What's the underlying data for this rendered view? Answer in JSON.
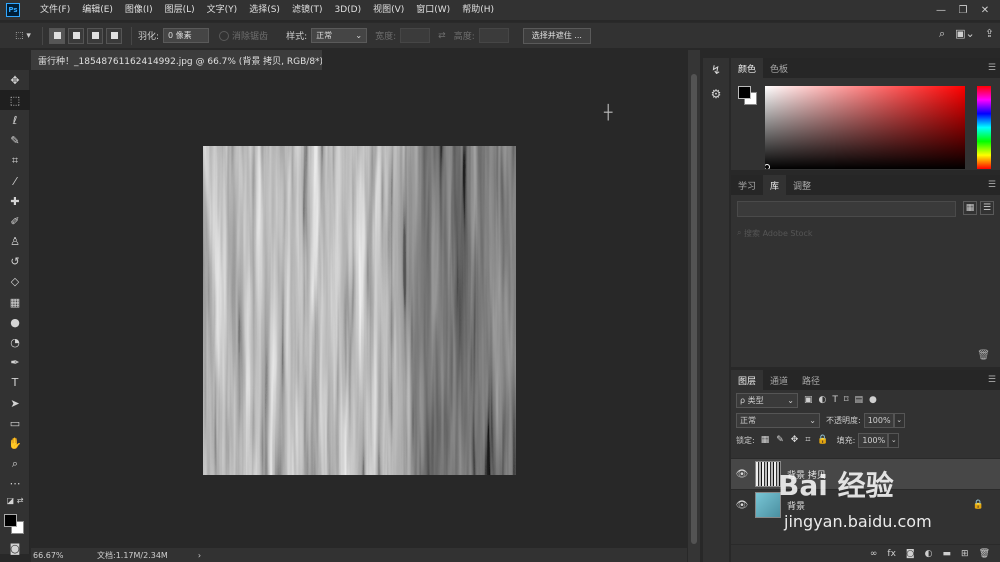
{
  "app": {
    "logo_text": "Ps"
  },
  "menu": [
    "文件(F)",
    "编辑(E)",
    "图像(I)",
    "图层(L)",
    "文字(Y)",
    "选择(S)",
    "滤镜(T)",
    "3D(D)",
    "视图(V)",
    "窗口(W)",
    "帮助(H)"
  ],
  "window_controls": {
    "minimize": "—",
    "restore": "❐",
    "close": "✕"
  },
  "options": {
    "feather_label": "羽化:",
    "feather_value": "0 像素",
    "antialias_label": "消除锯齿",
    "style_label": "样式:",
    "style_value": "正常",
    "width_label": "宽度:",
    "height_label": "高度:",
    "select_mask_button": "选择并遮住 ..."
  },
  "document": {
    "tab_title": "雷行种！_18548761162414992.jpg @ 66.7% (背景 拷贝, RGB/8*) *",
    "close": "×",
    "zoom": "66.67%",
    "doc_info": "文档:1.17M/2.34M"
  },
  "panels": {
    "color_tabs": [
      "颜色",
      "色板"
    ],
    "library_tabs": [
      "学习",
      "库",
      "调整"
    ],
    "library_search_placeholder": "搜索 Adobe Stock",
    "layers_tabs": [
      "图层",
      "通道",
      "路径"
    ]
  },
  "layers": {
    "filter_label": "ρ 类型",
    "blend_mode": "正常",
    "opacity_label": "不透明度:",
    "opacity_value": "100%",
    "lock_label": "锁定:",
    "fill_label": "填充:",
    "fill_value": "100%",
    "items": [
      {
        "name": "背景 拷贝",
        "selected": true
      },
      {
        "name": "背景",
        "selected": false
      }
    ],
    "footer_icons": [
      "link-icon",
      "fx-icon",
      "mask-icon",
      "adjustment-icon",
      "group-icon",
      "new-layer-icon",
      "trash-icon"
    ]
  },
  "watermark": {
    "logo": "Bai 经验",
    "url": "jingyan.baidu.com"
  },
  "colors": {
    "foreground": "#000000",
    "background": "#ffffff",
    "accent": "#31a8ff"
  }
}
